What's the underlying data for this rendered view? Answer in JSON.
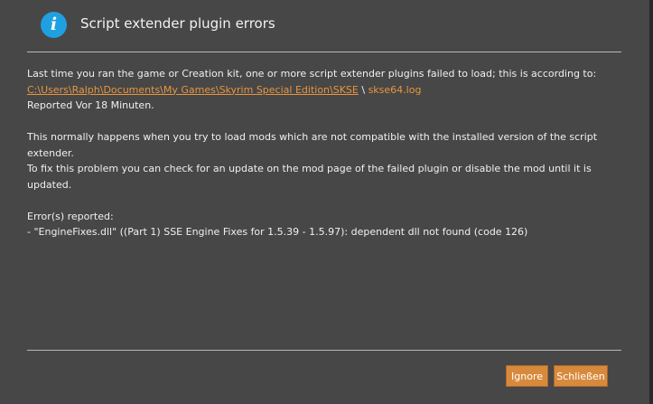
{
  "dialog": {
    "title": "Script extender plugin errors",
    "icon": "info-icon",
    "accent_color": "#1fa0e0"
  },
  "message": {
    "intro": "Last time you ran the game or Creation kit, one or more script extender plugins failed to load; this is according to:",
    "log_path": "C:\\Users\\Ralph\\Documents\\My Games\\Skyrim Special Edition\\SKSE",
    "path_separator": " \\ ",
    "log_file": "skse64.log",
    "reported": "Reported Vor 18 Minuten.",
    "explanation": "This normally happens when you try to load mods which are not compatible with the installed version of the script extender.",
    "fix_hint": "To fix this problem you can check for an update on the mod page of the failed plugin or disable the mod until it is updated.",
    "errors_heading": "Error(s) reported:",
    "errors": [
      "- \"EngineFixes.dll\" ((Part 1) SSE Engine Fixes for 1.5.39 - 1.5.97): dependent dll not found (code 126)"
    ]
  },
  "buttons": {
    "ignore_label": "Ignore",
    "close_label": "Schließen",
    "button_color": "#d88a3c"
  }
}
